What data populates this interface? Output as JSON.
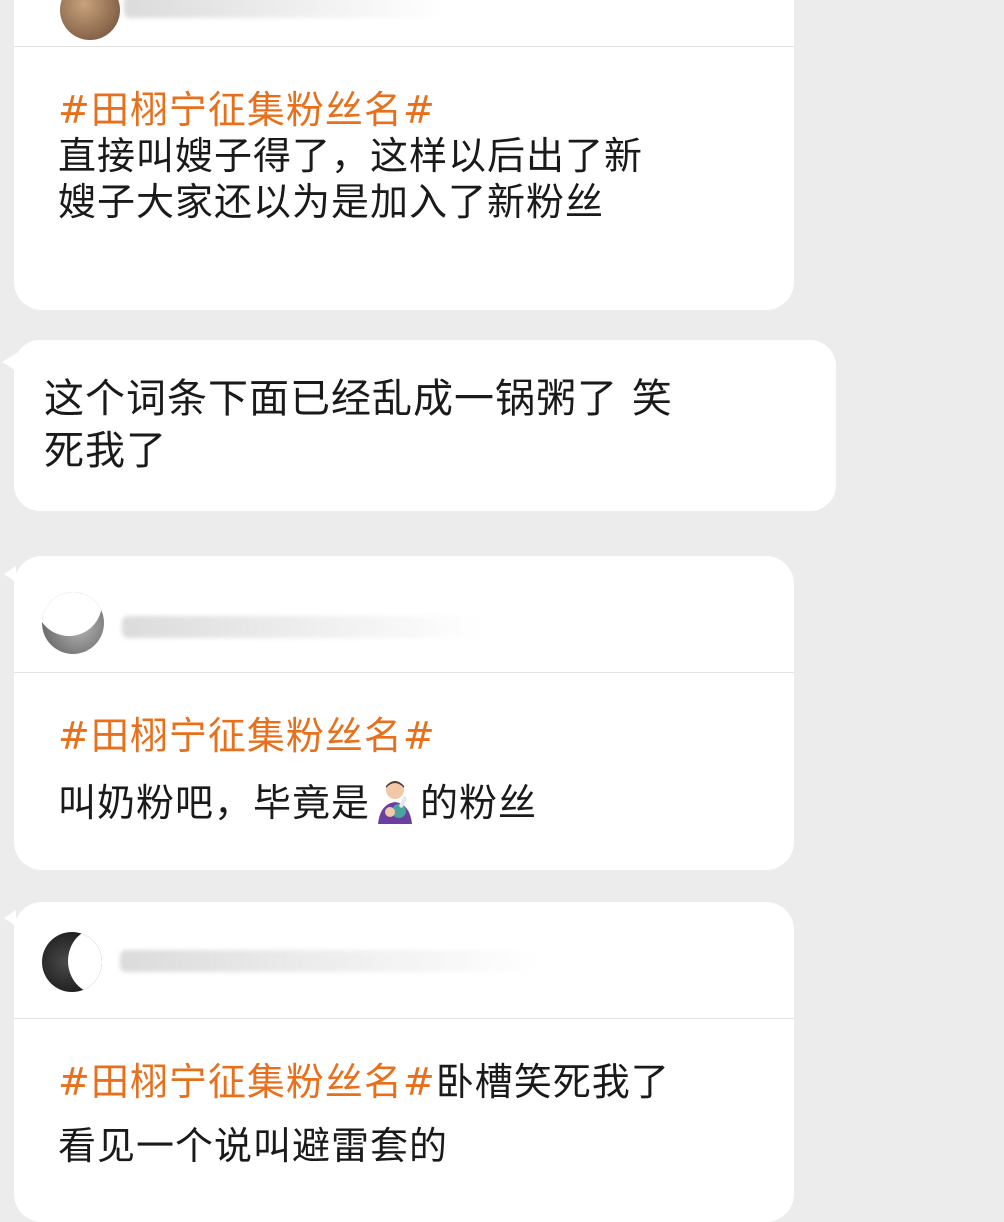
{
  "card1": {
    "hashtag": "#田栩宁征集粉丝名#",
    "line1": "直接叫嫂子得了，这样以后出了新",
    "line2": "嫂子大家还以为是加入了新粉丝"
  },
  "bubble": {
    "line1": "这个词条下面已经乱成一锅粥了 笑",
    "line2": "死我了"
  },
  "card2": {
    "hashtag": "#田栩宁征集粉丝名#",
    "text_before_emoji": "叫奶粉吧，毕竟是",
    "emoji": "parent-feeding-baby-emoji",
    "text_after_emoji": "的粉丝"
  },
  "card3": {
    "hashtag": "#田栩宁征集粉丝名#",
    "line1_rest": "卧槽笑死我了",
    "line2": "看见一个说叫避雷套的"
  },
  "colors": {
    "background": "#ececec",
    "card": "#ffffff",
    "hashtag": "#e8701c",
    "text": "#1a1a1a"
  }
}
